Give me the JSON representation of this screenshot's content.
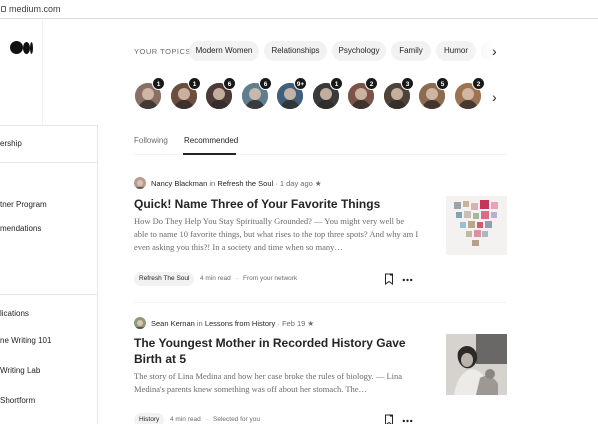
{
  "browser": {
    "url": "medium.com"
  },
  "side_panel": {
    "items": [
      {
        "label": "ership"
      },
      {
        "label": "tner Program"
      },
      {
        "label": "mendations"
      },
      {
        "label": "lications"
      },
      {
        "label": "ne Writing 101"
      },
      {
        "label": "Writing Lab"
      },
      {
        "label": "Shortform"
      }
    ]
  },
  "topics": {
    "label": "YOUR TOPICS",
    "chips": [
      "Modern Women",
      "Relationships",
      "Psychology",
      "Family",
      "Humor"
    ]
  },
  "avatars": [
    {
      "badge": "1",
      "color": "#8a6f64"
    },
    {
      "badge": "1",
      "color": "#6d4d3b"
    },
    {
      "badge": "6",
      "color": "#4b3a36"
    },
    {
      "badge": "6",
      "color": "#5f7f8f"
    },
    {
      "badge": "9+",
      "color": "#3f5f7a"
    },
    {
      "badge": "1",
      "color": "#3b3a3a"
    },
    {
      "badge": "2",
      "color": "#7a5448"
    },
    {
      "badge": "3",
      "color": "#4e4339"
    },
    {
      "badge": "5",
      "color": "#8c6b4e"
    },
    {
      "badge": "2",
      "color": "#9e7352"
    }
  ],
  "tabs": [
    {
      "label": "Following",
      "active": false
    },
    {
      "label": "Recommended",
      "active": true
    }
  ],
  "articles": [
    {
      "author": "Nancy Blackman",
      "in_word": "in",
      "publication": "Refresh the Soul",
      "date": "1 day ago",
      "star": "★",
      "title": "Quick! Name Three of Your Favorite Things",
      "excerpt": "How Do They Help You Stay Spiritually Grounded? — You might very well be able to name 10 favorite things, but what rises to the top three spots? And why am I even asking you this?! In a society and time when so many…",
      "tag": "Refresh The Soul",
      "read_time": "4 min read",
      "reason": "From your network"
    },
    {
      "author": "Sean Kernan",
      "in_word": "in",
      "publication": "Lessons from History",
      "date": "Feb 19",
      "star": "★",
      "title": "The Youngest Mother in Recorded History Gave Birth at 5",
      "excerpt": "The story of Lina Medina and how her case broke the rules of biology. — Lina Medina's parents knew something was off about her stomach. The…",
      "tag": "History",
      "read_time": "4 min read",
      "reason": "Selected for you"
    }
  ],
  "icons": {
    "bookmark": "bookmark-icon",
    "more": "more-icon",
    "chevron": "chevron-right-icon"
  }
}
